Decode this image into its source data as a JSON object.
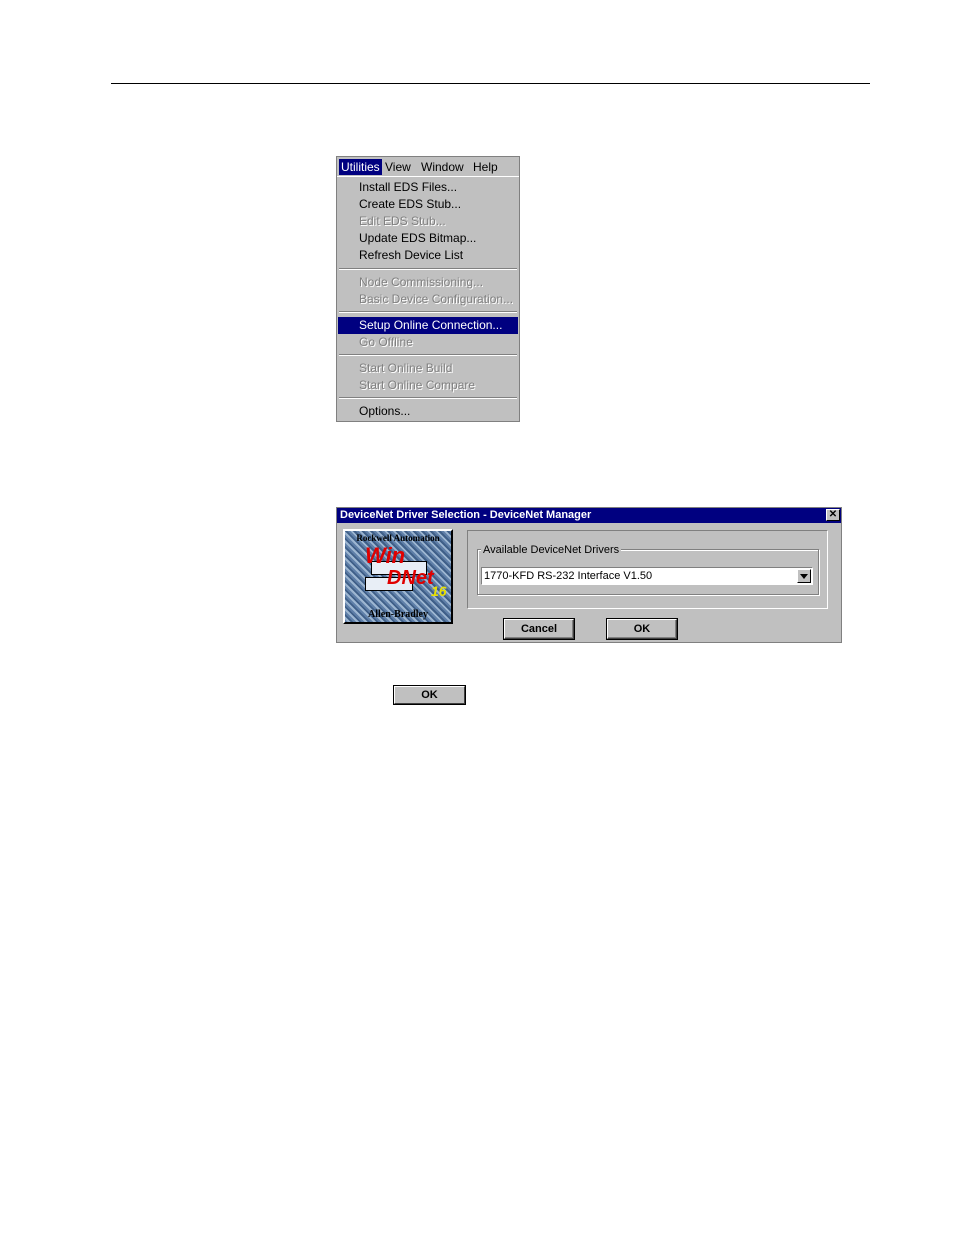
{
  "menubar": {
    "items": [
      "Utilities",
      "View",
      "Window",
      "Help"
    ],
    "active": "Utilities"
  },
  "menu": {
    "items": [
      {
        "label": "Install EDS Files...",
        "state": "enabled"
      },
      {
        "label": "Create EDS Stub...",
        "state": "enabled"
      },
      {
        "label": "Edit EDS Stub...",
        "state": "disabled"
      },
      {
        "label": "Update EDS Bitmap...",
        "state": "enabled"
      },
      {
        "label": "Refresh Device List",
        "state": "enabled"
      },
      {
        "label": "Node Commissioning...",
        "state": "disabled"
      },
      {
        "label": "Basic Device Configuration...",
        "state": "disabled"
      },
      {
        "label": "Setup Online Connection...",
        "state": "highlighted"
      },
      {
        "label": "Go Offline",
        "state": "disabled"
      },
      {
        "label": "Start Online Build",
        "state": "disabled"
      },
      {
        "label": "Start Online Compare",
        "state": "disabled"
      },
      {
        "label": "Options...",
        "state": "enabled"
      }
    ]
  },
  "dialog": {
    "title": "DeviceNet Driver Selection - DeviceNet Manager",
    "close_symbol": "✕",
    "logo": {
      "top_text": "Rockwell Automation",
      "win_text": "Win",
      "dnet_text": "DNet",
      "version_text": "16",
      "bottom_text": "Allen-Bradley"
    },
    "group_label": "Available DeviceNet Drivers",
    "selected_driver": "1770-KFD RS-232 Interface V1.50",
    "cancel_label": "Cancel",
    "ok_label": "OK"
  },
  "standalone_ok_label": "OK"
}
